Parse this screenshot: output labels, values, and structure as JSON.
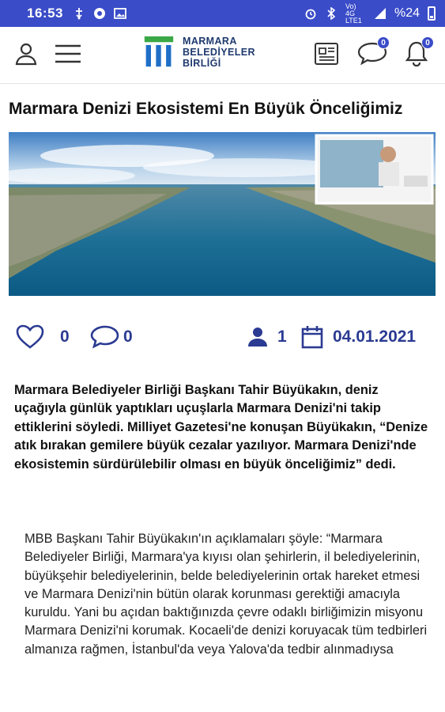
{
  "status_bar": {
    "time": "16:53",
    "network_label": "Vo) 4G LTE1",
    "battery": "%24",
    "icons": [
      "usb-icon",
      "vpn-icon",
      "image-icon",
      "alarm-icon",
      "bluetooth-icon",
      "signal-icon",
      "battery-icon"
    ]
  },
  "app_bar": {
    "logo_lines": [
      "MARMARA",
      "BELEDİYELER",
      "BİRLİĞİ"
    ],
    "newspaper_count": "",
    "messages_badge": "0",
    "notifications_badge": "0",
    "colors": {
      "status": "#3a4cc8",
      "accent": "#2b3a92",
      "logo_green": "#3aa845",
      "logo_blue": "#1f6fc7"
    }
  },
  "article": {
    "title": "Marmara Denizi Ekosistemi En Büyük Önceliğimiz",
    "likes": "0",
    "comments": "0",
    "views": "1",
    "date": "04.01.2021",
    "lead": "Marmara Belediyeler Birliği Başkanı Tahir Büyükakın, deniz uçağıyla günlük yaptıkları uçuşlarla Marmara Denizi'ni takip ettiklerini söyledi. Milliyet Gazetesi'ne konuşan Büyükakın, “Denize atık bırakan gemilere büyük cezalar yazılıyor. Marmara Denizi'nde ekosistemin sürdürülebilir olması en büyük önceliğimiz” dedi.",
    "body": "MBB Başkanı Tahir Büyükakın'ın açıklamaları şöyle: “Marmara Belediyeler Birliği, Marmara'ya kıyısı olan şehirlerin, il belediyelerinin, büyükşehir belediyelerinin, belde belediyelerinin ortak hareket etmesi ve Marmara Denizi'nin bütün olarak korunması gerektiği amacıyla kuruldu. Yani bu açıdan baktığınızda çevre odaklı birliğimizin misyonu Marmara Denizi'ni korumak. Kocaeli'de denizi koruyacak tüm tedbirleri almanıza rağmen, İstanbul'da veya Yalova'da tedbir alınmadıysa"
  }
}
